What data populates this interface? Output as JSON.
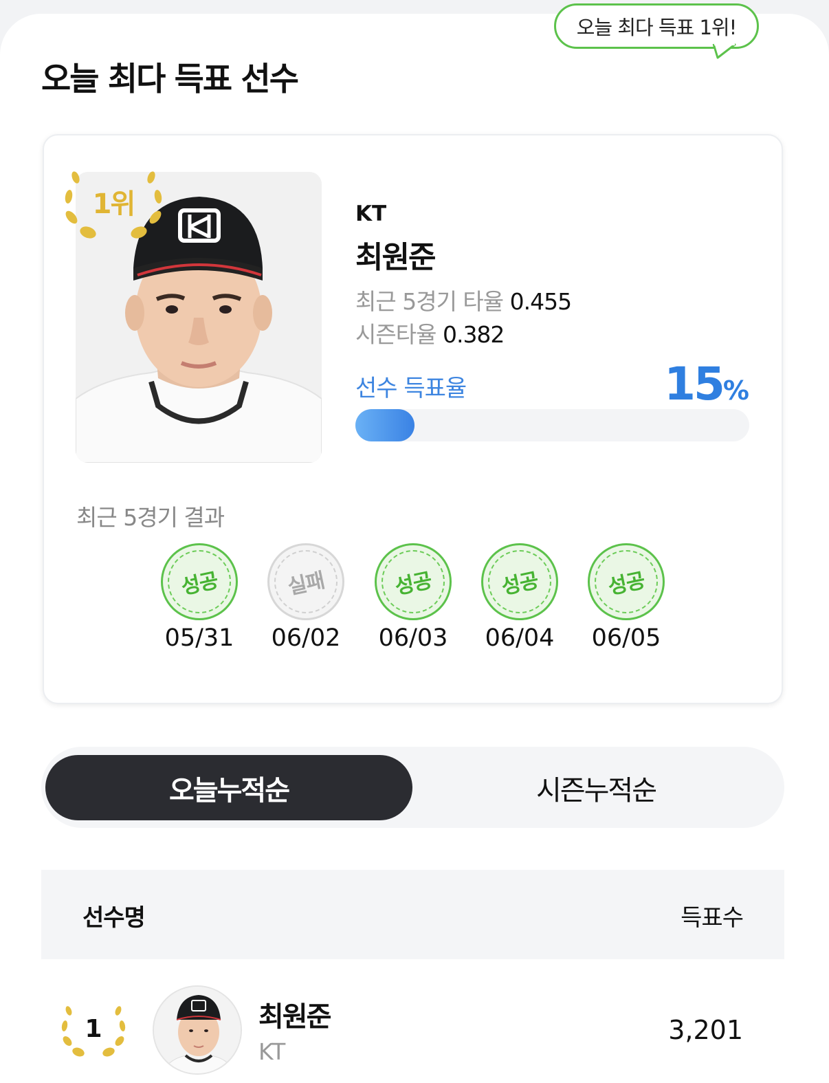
{
  "badge": {
    "text": "오늘 최다 득표 1위!"
  },
  "section": {
    "title": "오늘 최다 득표 선수"
  },
  "featured": {
    "rank_label": "1위",
    "team": "KT",
    "name": "최원준",
    "stat1_label": "최근 5경기 타율",
    "stat1_value": "0.455",
    "stat2_label": "시즌타율",
    "stat2_value": "0.382",
    "vote_label": "선수 득표율",
    "vote_percent": "15",
    "vote_unit": "%",
    "vote_fraction": 0.15,
    "recent_label": "최근 5경기 결과",
    "results": [
      {
        "stamp": "성공",
        "date": "05/31",
        "success": true
      },
      {
        "stamp": "실패",
        "date": "06/02",
        "success": false
      },
      {
        "stamp": "성공",
        "date": "06/03",
        "success": true
      },
      {
        "stamp": "성공",
        "date": "06/04",
        "success": true
      },
      {
        "stamp": "성공",
        "date": "06/05",
        "success": true
      }
    ]
  },
  "tabs": [
    {
      "label": "오늘누적순",
      "active": true
    },
    {
      "label": "시즌누적순",
      "active": false
    }
  ],
  "table": {
    "col_name": "선수명",
    "col_votes": "득표수",
    "rows": [
      {
        "rank": "1",
        "name": "최원준",
        "team": "KT",
        "votes": "3,201"
      }
    ]
  },
  "colors": {
    "accent_green": "#5cc24b",
    "accent_blue": "#2f7fe0",
    "gold": "#e0b534",
    "tab_active": "#2b2c31"
  },
  "icons": {
    "laurel": "laurel-wreath-icon",
    "stamp": "result-stamp-icon"
  }
}
